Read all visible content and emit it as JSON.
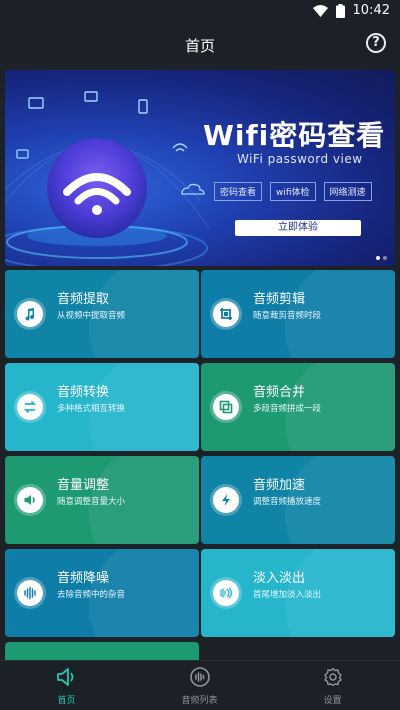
{
  "status": {
    "time": "10:42"
  },
  "header": {
    "title": "首页"
  },
  "banner": {
    "headline": "Wifi密码查看",
    "subtitle": "WiFi password view",
    "tags": [
      "密码查看",
      "wifi体检",
      "网络测速"
    ],
    "cta": "立即体验"
  },
  "cards": [
    {
      "title": "音频提取",
      "desc": "从视频中提取音频",
      "icon": "music-note-icon",
      "color": "#0f84a6"
    },
    {
      "title": "音频剪辑",
      "desc": "随意裁剪音频时段",
      "icon": "crop-icon",
      "color": "#0e7ea8"
    },
    {
      "title": "音频转换",
      "desc": "多种格式相互转换",
      "icon": "swap-arrows-icon",
      "color": "#25b6cc"
    },
    {
      "title": "音频合并",
      "desc": "多段音频拼成一段",
      "icon": "merge-squares-icon",
      "color": "#1e9a73"
    },
    {
      "title": "音量调整",
      "desc": "随意调整音量大小",
      "icon": "speaker-icon",
      "color": "#1e9a73"
    },
    {
      "title": "音频加速",
      "desc": "调整音频播放速度",
      "icon": "lightning-icon",
      "color": "#0f84a6"
    },
    {
      "title": "音频降噪",
      "desc": "去除音频中的杂音",
      "icon": "waveform-icon",
      "color": "#0e7ea8"
    },
    {
      "title": "淡入淡出",
      "desc": "首尾增加淡入淡出",
      "icon": "fade-wave-icon",
      "color": "#25b6cc"
    }
  ],
  "tabs": [
    {
      "label": "首页",
      "icon": "speaker-outline-icon",
      "active": true
    },
    {
      "label": "音频列表",
      "icon": "audio-list-icon",
      "active": false
    },
    {
      "label": "设置",
      "icon": "gear-icon",
      "active": false
    }
  ],
  "colors": {
    "accent": "#29c4b0",
    "tab_inactive": "#8c959d",
    "background": "#1c2228"
  }
}
